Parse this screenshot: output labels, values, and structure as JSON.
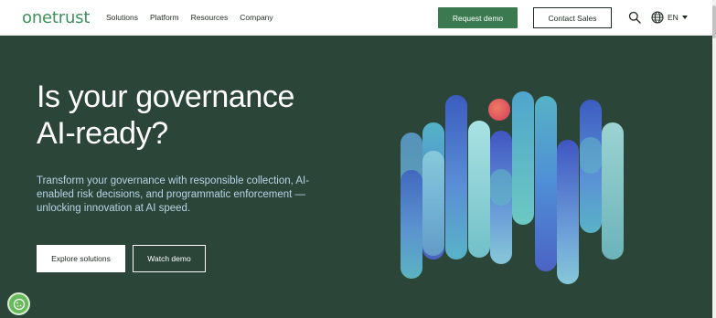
{
  "header": {
    "logo": "onetrust",
    "nav": [
      "Solutions",
      "Platform",
      "Resources",
      "Company"
    ],
    "request_demo": "Request demo",
    "contact_sales": "Contact Sales",
    "language": "EN",
    "search_icon": "search-icon",
    "globe_icon": "globe-icon"
  },
  "hero": {
    "headline_line1": "Is your governance",
    "headline_line2": "AI-ready?",
    "subheadline": "Transform your governance with responsible collection, AI-enabled risk decisions, and programmatic enforcement — unlocking innovation at AI speed.",
    "explore_button": "Explore solutions",
    "watch_button": "Watch demo"
  },
  "colors": {
    "brand_green": "#3e8f5c",
    "cta_green": "#3b7a50",
    "hero_bg": "#2b4539",
    "sub_text": "#b9d4e6"
  },
  "cookie_icon": "cookie-settings-icon"
}
